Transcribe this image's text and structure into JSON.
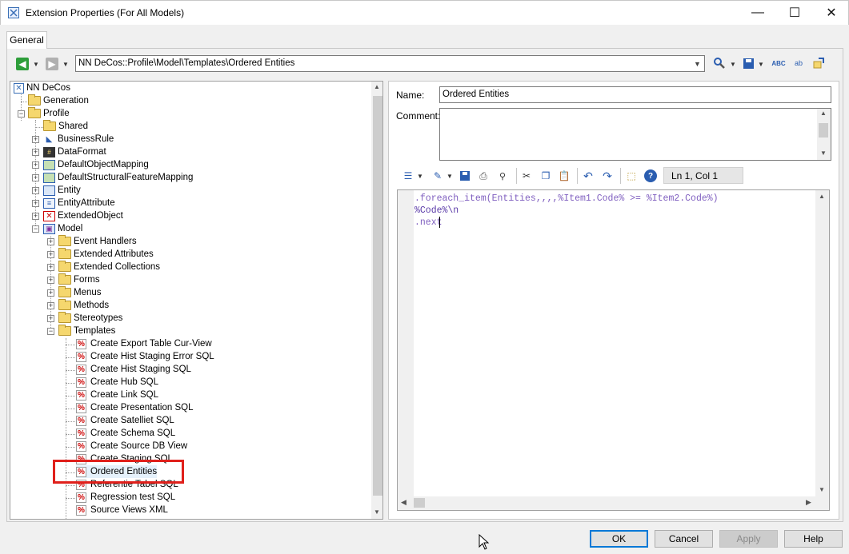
{
  "window": {
    "title": "Extension Properties (For All Models)",
    "minimize": "—",
    "maximize": "☐",
    "close": "✕"
  },
  "tabs": [
    {
      "label": "General"
    }
  ],
  "toolbar": {
    "path": "NN DeCos::Profile\\Model\\Templates\\Ordered Entities"
  },
  "tree": {
    "root": "NN DeCos",
    "items": [
      {
        "label": "Generation"
      },
      {
        "label": "Profile"
      },
      {
        "label": "Shared"
      },
      {
        "label": "BusinessRule"
      },
      {
        "label": "DataFormat"
      },
      {
        "label": "DefaultObjectMapping"
      },
      {
        "label": "DefaultStructuralFeatureMapping"
      },
      {
        "label": "Entity"
      },
      {
        "label": "EntityAttribute"
      },
      {
        "label": "ExtendedObject"
      },
      {
        "label": "Model"
      },
      {
        "label": "Event Handlers"
      },
      {
        "label": "Extended Attributes"
      },
      {
        "label": "Extended Collections"
      },
      {
        "label": "Forms"
      },
      {
        "label": "Menus"
      },
      {
        "label": "Methods"
      },
      {
        "label": "Stereotypes"
      },
      {
        "label": "Templates"
      },
      {
        "label": "Create Export Table Cur-View"
      },
      {
        "label": "Create Hist Staging Error SQL"
      },
      {
        "label": "Create Hist Staging SQL"
      },
      {
        "label": "Create Hub SQL"
      },
      {
        "label": "Create Link SQL"
      },
      {
        "label": "Create Presentation SQL"
      },
      {
        "label": "Create Satelliet SQL"
      },
      {
        "label": "Create Schema SQL"
      },
      {
        "label": "Create Source DB View"
      },
      {
        "label": "Create Staging SQL"
      },
      {
        "label": "Ordered Entities"
      },
      {
        "label": "Referentie Tabel SQL"
      },
      {
        "label": "Regression test SQL"
      },
      {
        "label": "Source Views XML"
      }
    ]
  },
  "form": {
    "name_label": "Name:",
    "name_value": "Ordered Entities",
    "comment_label": "Comment:",
    "comment_value": ""
  },
  "editor": {
    "cursor_position": "Ln 1, Col 1",
    "line1": ".foreach_item(Entities,,,,%Item1.Code% >= %Item2.Code%)",
    "line2": "%Code%\\n",
    "line3": ".next"
  },
  "buttons": {
    "ok": "OK",
    "cancel": "Cancel",
    "apply": "Apply",
    "help": "Help"
  },
  "colors": {
    "highlight": "#e0201b",
    "accent": "#0078d7"
  }
}
